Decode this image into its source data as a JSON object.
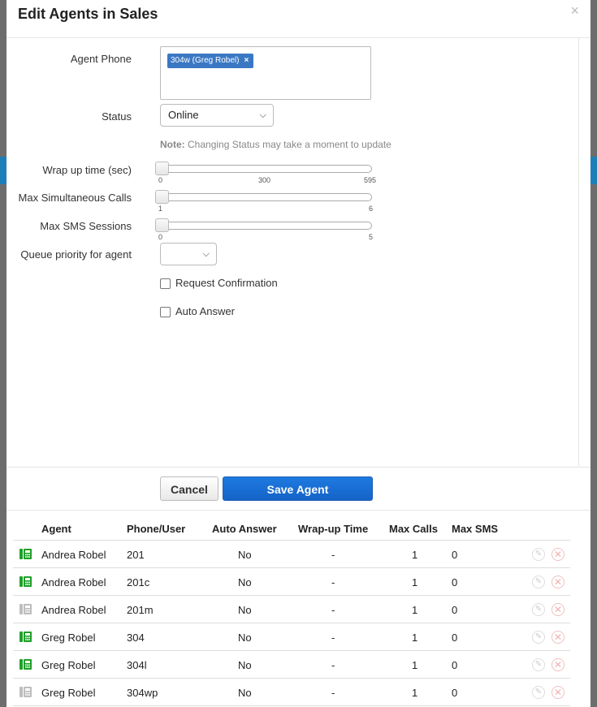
{
  "modal": {
    "title": "Edit Agents in Sales",
    "close_icon": "×"
  },
  "form": {
    "agent_phone_label": "Agent Phone",
    "agent_phone_tag": "304w (Greg Robel)",
    "agent_phone_tag_remove": "×",
    "status_label": "Status",
    "status_value": "Online",
    "note_bold": "Note:",
    "note_text": " Changing Status may take a moment to update",
    "wrap_up_label": "Wrap up time (sec)",
    "wrap_up_ticks": [
      "0",
      "300",
      "595"
    ],
    "max_calls_label": "Max Simultaneous Calls",
    "max_calls_ticks": [
      "1",
      "6"
    ],
    "max_sms_label": "Max SMS Sessions",
    "max_sms_ticks": [
      "0",
      "5"
    ],
    "queue_priority_label": "Queue priority for agent",
    "queue_priority_value": "",
    "request_confirmation_label": "Request Confirmation",
    "auto_answer_label": "Auto Answer"
  },
  "buttons": {
    "cancel": "Cancel",
    "save": "Save Agent"
  },
  "table": {
    "headers": [
      "Agent",
      "Phone/User",
      "Auto Answer",
      "Wrap-up Time",
      "Max Calls",
      "Max SMS"
    ],
    "rows": [
      {
        "agent": "Andrea Robel",
        "phone": "201",
        "auto_answer": "No",
        "wrap_up": "-",
        "max_calls": "1",
        "max_sms": "0",
        "status": "online"
      },
      {
        "agent": "Andrea Robel",
        "phone": "201c",
        "auto_answer": "No",
        "wrap_up": "-",
        "max_calls": "1",
        "max_sms": "0",
        "status": "online"
      },
      {
        "agent": "Andrea Robel",
        "phone": "201m",
        "auto_answer": "No",
        "wrap_up": "-",
        "max_calls": "1",
        "max_sms": "0",
        "status": "offline"
      },
      {
        "agent": "Greg Robel",
        "phone": "304",
        "auto_answer": "No",
        "wrap_up": "-",
        "max_calls": "1",
        "max_sms": "0",
        "status": "online"
      },
      {
        "agent": "Greg Robel",
        "phone": "304l",
        "auto_answer": "No",
        "wrap_up": "-",
        "max_calls": "1",
        "max_sms": "0",
        "status": "online"
      },
      {
        "agent": "Greg Robel",
        "phone": "304wp",
        "auto_answer": "No",
        "wrap_up": "-",
        "max_calls": "1",
        "max_sms": "0",
        "status": "offline"
      }
    ]
  },
  "colors": {
    "accent": "#1e7ae0",
    "tag": "#3a78c4",
    "online_phone": "#1fa02a",
    "offline_phone": "#bdbdbd"
  }
}
